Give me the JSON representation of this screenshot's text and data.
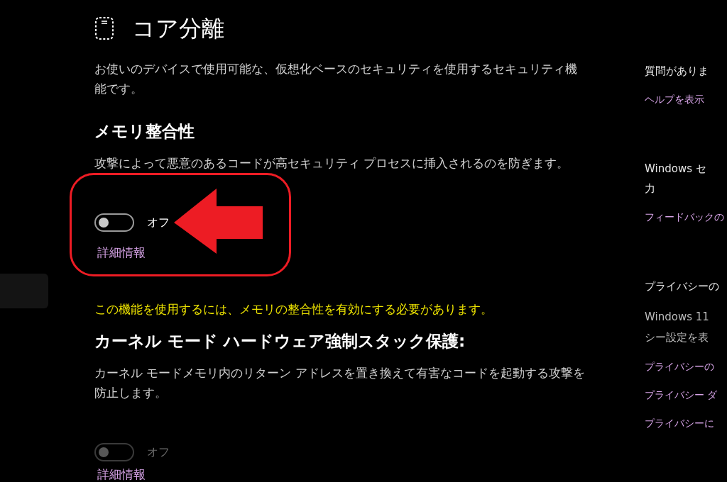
{
  "sidebar": {
    "items": [
      {
        "selected": true
      }
    ]
  },
  "page": {
    "title": "コア分離",
    "description": "お使いのデバイスで使用可能な、仮想化ベースのセキュリティを使用するセキュリティ機能です。"
  },
  "sections": [
    {
      "heading": "メモリ整合性",
      "description": "攻撃によって悪意のあるコードが高セキュリティ プロセスに挿入されるのを防ぎます。",
      "toggle": {
        "on": false,
        "disabled": false,
        "label": "オフ"
      },
      "annotation": {
        "outline": true,
        "arrow": true
      },
      "link": "詳細情報"
    },
    {
      "warning": "この機能を使用するには、メモリの整合性を有効にする必要があります。",
      "heading": "カーネル モード ハードウェア強制スタック保護:",
      "description": "カーネル モードメモリ内のリターン アドレスを置き換えて有害なコードを起動する攻撃を防止します。",
      "toggle": {
        "on": false,
        "disabled": true,
        "label": "オフ"
      },
      "link": "詳細情報"
    }
  ],
  "aside": {
    "sections": [
      {
        "heading_lines": [
          "質問がありま"
        ],
        "links": [
          "ヘルプを表示"
        ]
      },
      {
        "heading_lines": [
          "Windows セ",
          "力"
        ],
        "links": [
          "フィードバックの"
        ]
      },
      {
        "heading_lines": [
          "プライバシーの"
        ],
        "text_lines": [
          "Windows 11",
          "シー設定を表"
        ],
        "links": [
          "プライバシーの",
          "プライバシー ダ",
          "プライバシーに"
        ]
      }
    ]
  }
}
